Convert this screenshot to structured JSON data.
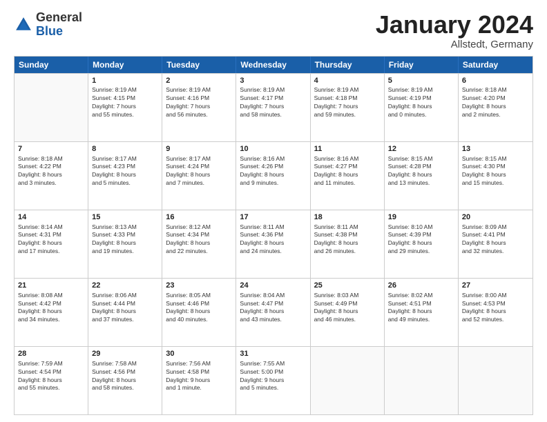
{
  "logo": {
    "general": "General",
    "blue": "Blue"
  },
  "title": "January 2024",
  "subtitle": "Allstedt, Germany",
  "headers": [
    "Sunday",
    "Monday",
    "Tuesday",
    "Wednesday",
    "Thursday",
    "Friday",
    "Saturday"
  ],
  "weeks": [
    [
      {
        "day": "",
        "info": ""
      },
      {
        "day": "1",
        "info": "Sunrise: 8:19 AM\nSunset: 4:15 PM\nDaylight: 7 hours\nand 55 minutes."
      },
      {
        "day": "2",
        "info": "Sunrise: 8:19 AM\nSunset: 4:16 PM\nDaylight: 7 hours\nand 56 minutes."
      },
      {
        "day": "3",
        "info": "Sunrise: 8:19 AM\nSunset: 4:17 PM\nDaylight: 7 hours\nand 58 minutes."
      },
      {
        "day": "4",
        "info": "Sunrise: 8:19 AM\nSunset: 4:18 PM\nDaylight: 7 hours\nand 59 minutes."
      },
      {
        "day": "5",
        "info": "Sunrise: 8:19 AM\nSunset: 4:19 PM\nDaylight: 8 hours\nand 0 minutes."
      },
      {
        "day": "6",
        "info": "Sunrise: 8:18 AM\nSunset: 4:20 PM\nDaylight: 8 hours\nand 2 minutes."
      }
    ],
    [
      {
        "day": "7",
        "info": "Sunrise: 8:18 AM\nSunset: 4:22 PM\nDaylight: 8 hours\nand 3 minutes."
      },
      {
        "day": "8",
        "info": "Sunrise: 8:17 AM\nSunset: 4:23 PM\nDaylight: 8 hours\nand 5 minutes."
      },
      {
        "day": "9",
        "info": "Sunrise: 8:17 AM\nSunset: 4:24 PM\nDaylight: 8 hours\nand 7 minutes."
      },
      {
        "day": "10",
        "info": "Sunrise: 8:16 AM\nSunset: 4:26 PM\nDaylight: 8 hours\nand 9 minutes."
      },
      {
        "day": "11",
        "info": "Sunrise: 8:16 AM\nSunset: 4:27 PM\nDaylight: 8 hours\nand 11 minutes."
      },
      {
        "day": "12",
        "info": "Sunrise: 8:15 AM\nSunset: 4:28 PM\nDaylight: 8 hours\nand 13 minutes."
      },
      {
        "day": "13",
        "info": "Sunrise: 8:15 AM\nSunset: 4:30 PM\nDaylight: 8 hours\nand 15 minutes."
      }
    ],
    [
      {
        "day": "14",
        "info": "Sunrise: 8:14 AM\nSunset: 4:31 PM\nDaylight: 8 hours\nand 17 minutes."
      },
      {
        "day": "15",
        "info": "Sunrise: 8:13 AM\nSunset: 4:33 PM\nDaylight: 8 hours\nand 19 minutes."
      },
      {
        "day": "16",
        "info": "Sunrise: 8:12 AM\nSunset: 4:34 PM\nDaylight: 8 hours\nand 22 minutes."
      },
      {
        "day": "17",
        "info": "Sunrise: 8:11 AM\nSunset: 4:36 PM\nDaylight: 8 hours\nand 24 minutes."
      },
      {
        "day": "18",
        "info": "Sunrise: 8:11 AM\nSunset: 4:38 PM\nDaylight: 8 hours\nand 26 minutes."
      },
      {
        "day": "19",
        "info": "Sunrise: 8:10 AM\nSunset: 4:39 PM\nDaylight: 8 hours\nand 29 minutes."
      },
      {
        "day": "20",
        "info": "Sunrise: 8:09 AM\nSunset: 4:41 PM\nDaylight: 8 hours\nand 32 minutes."
      }
    ],
    [
      {
        "day": "21",
        "info": "Sunrise: 8:08 AM\nSunset: 4:42 PM\nDaylight: 8 hours\nand 34 minutes."
      },
      {
        "day": "22",
        "info": "Sunrise: 8:06 AM\nSunset: 4:44 PM\nDaylight: 8 hours\nand 37 minutes."
      },
      {
        "day": "23",
        "info": "Sunrise: 8:05 AM\nSunset: 4:46 PM\nDaylight: 8 hours\nand 40 minutes."
      },
      {
        "day": "24",
        "info": "Sunrise: 8:04 AM\nSunset: 4:47 PM\nDaylight: 8 hours\nand 43 minutes."
      },
      {
        "day": "25",
        "info": "Sunrise: 8:03 AM\nSunset: 4:49 PM\nDaylight: 8 hours\nand 46 minutes."
      },
      {
        "day": "26",
        "info": "Sunrise: 8:02 AM\nSunset: 4:51 PM\nDaylight: 8 hours\nand 49 minutes."
      },
      {
        "day": "27",
        "info": "Sunrise: 8:00 AM\nSunset: 4:53 PM\nDaylight: 8 hours\nand 52 minutes."
      }
    ],
    [
      {
        "day": "28",
        "info": "Sunrise: 7:59 AM\nSunset: 4:54 PM\nDaylight: 8 hours\nand 55 minutes."
      },
      {
        "day": "29",
        "info": "Sunrise: 7:58 AM\nSunset: 4:56 PM\nDaylight: 8 hours\nand 58 minutes."
      },
      {
        "day": "30",
        "info": "Sunrise: 7:56 AM\nSunset: 4:58 PM\nDaylight: 9 hours\nand 1 minute."
      },
      {
        "day": "31",
        "info": "Sunrise: 7:55 AM\nSunset: 5:00 PM\nDaylight: 9 hours\nand 5 minutes."
      },
      {
        "day": "",
        "info": ""
      },
      {
        "day": "",
        "info": ""
      },
      {
        "day": "",
        "info": ""
      }
    ]
  ]
}
